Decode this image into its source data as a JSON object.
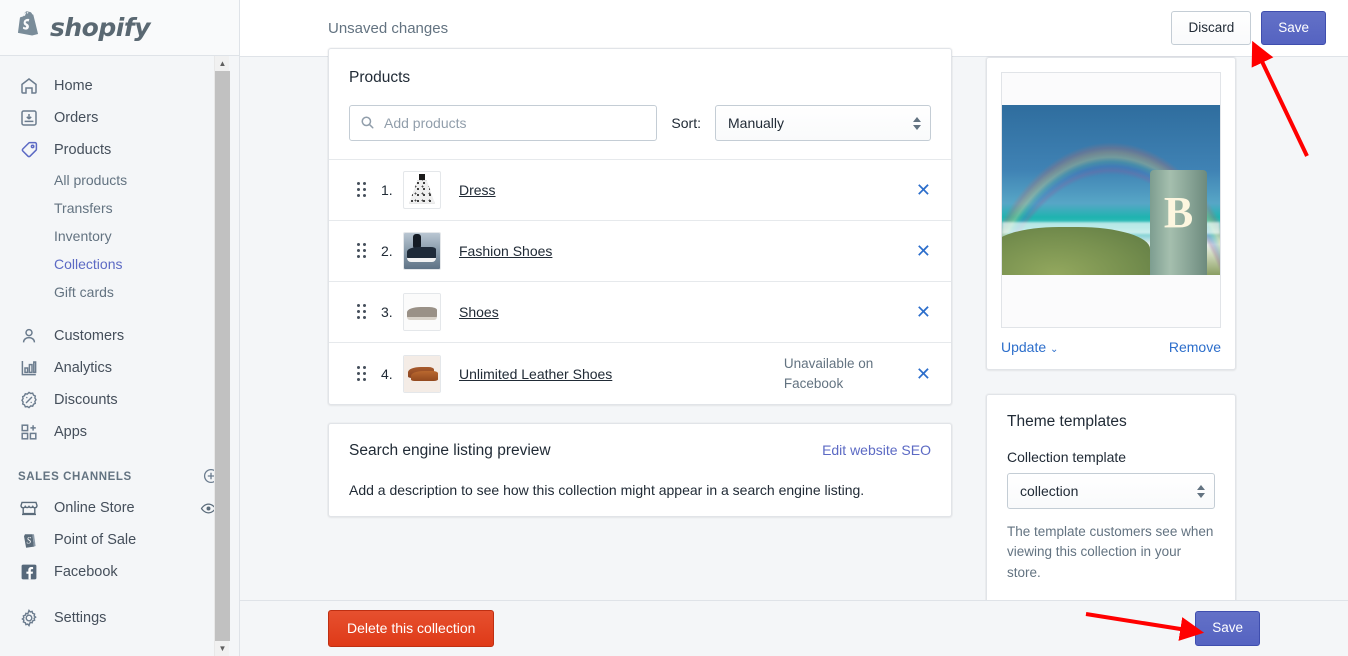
{
  "brand": {
    "name": "shopify"
  },
  "sidebar": {
    "items": [
      {
        "label": "Home",
        "icon": "home-icon"
      },
      {
        "label": "Orders",
        "icon": "orders-inbox-icon"
      },
      {
        "label": "Products",
        "icon": "tag-icon"
      }
    ],
    "product_subitems": [
      {
        "label": "All products",
        "active": false
      },
      {
        "label": "Transfers",
        "active": false
      },
      {
        "label": "Inventory",
        "active": false
      },
      {
        "label": "Collections",
        "active": true
      },
      {
        "label": "Gift cards",
        "active": false
      }
    ],
    "items2": [
      {
        "label": "Customers",
        "icon": "person-icon"
      },
      {
        "label": "Analytics",
        "icon": "bar-chart-icon"
      },
      {
        "label": "Discounts",
        "icon": "discount-percent-icon"
      },
      {
        "label": "Apps",
        "icon": "apps-grid-icon"
      }
    ],
    "sales_channels_heading": "SALES CHANNELS",
    "channels": [
      {
        "label": "Online Store",
        "icon": "storefront-icon",
        "trailing_icon": "eye-icon"
      },
      {
        "label": "Point of Sale",
        "icon": "pos-bag-icon"
      },
      {
        "label": "Facebook",
        "icon": "facebook-icon"
      }
    ],
    "settings": {
      "label": "Settings",
      "icon": "gear-icon"
    }
  },
  "topbar": {
    "title": "Unsaved changes",
    "discard_label": "Discard",
    "save_label": "Save"
  },
  "products_card": {
    "title": "Products",
    "search_placeholder": "Add products",
    "search_value": "",
    "sort_label": "Sort:",
    "sort_value": "Manually",
    "rows": [
      {
        "num": "1.",
        "name": "Dress",
        "status": "",
        "thumb": "dress-thumbnail"
      },
      {
        "num": "2.",
        "name": "Fashion Shoes",
        "status": "",
        "thumb": "sneaker-thumbnail"
      },
      {
        "num": "3.",
        "name": "Shoes",
        "status": "",
        "thumb": "grey-shoe-thumbnail"
      },
      {
        "num": "4.",
        "name": "Unlimited Leather Shoes",
        "status": "Unavailable on Facebook",
        "thumb": "leather-shoes-thumbnail"
      }
    ]
  },
  "seo_card": {
    "title": "Search engine listing preview",
    "edit_link": "Edit website SEO",
    "body": "Add a description to see how this collection might appear in a search engine listing."
  },
  "image_card": {
    "update_label": "Update",
    "remove_label": "Remove",
    "photo_letter": "B"
  },
  "theme_card": {
    "title": "Theme templates",
    "field_label": "Collection template",
    "select_value": "collection",
    "help_text": "The template customers see when viewing this collection in your store."
  },
  "bottombar": {
    "delete_label": "Delete this collection",
    "save_label": "Save"
  },
  "colors": {
    "accent": "#5c6ac4",
    "destructive": "#df3a18",
    "link": "#2c6ecb",
    "annotation": "#ff0000",
    "bg": "#f4f6f8"
  }
}
